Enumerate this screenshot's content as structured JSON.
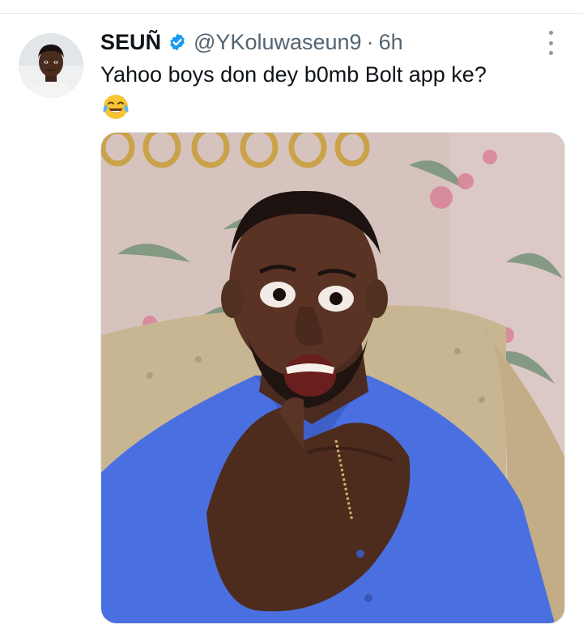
{
  "tweet": {
    "author": {
      "display_name": "SEUÑ",
      "handle": "@YKoluwaseun9",
      "verified": true
    },
    "separator": "·",
    "time": "6h",
    "text": "Yahoo boys don dey b0mb Bolt app ke?",
    "emoji": "😂",
    "media": {
      "alt": "meme photo of a surprised man in a blue shirt",
      "description": "surprised-man-meme"
    }
  },
  "colors": {
    "verified_badge": "#1d9bf0",
    "secondary_text": "#536471",
    "shirt_blue": "#4a6fe0"
  },
  "icons": {
    "verified": "verified-badge-icon",
    "more": "more-options-icon",
    "emoji": "face-with-tears-of-joy-icon"
  }
}
